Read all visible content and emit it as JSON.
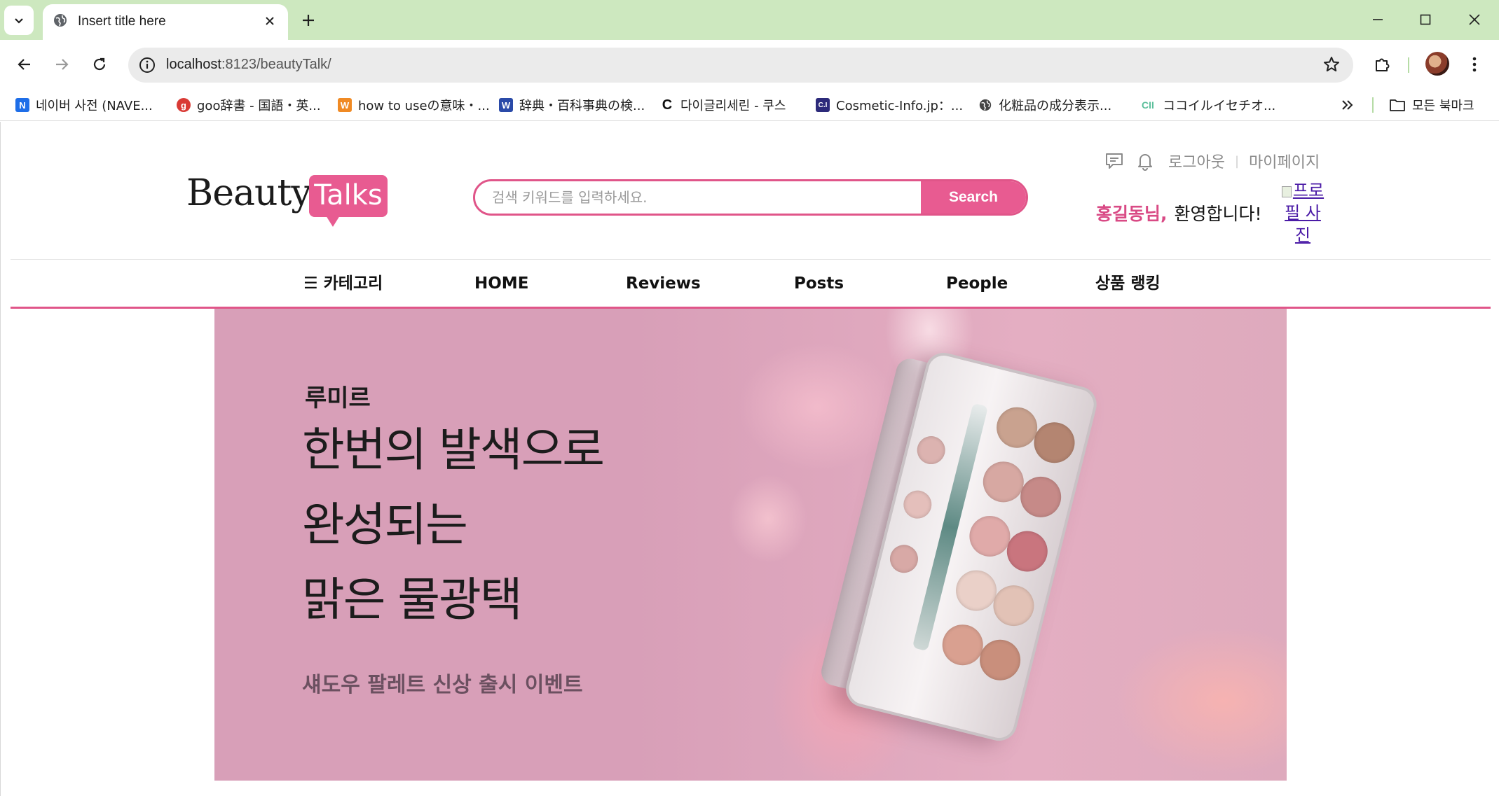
{
  "browser": {
    "tab_title": "Insert title here",
    "url_host": "localhost",
    "url_rest": ":8123/beautyTalk/",
    "bookmarks": [
      {
        "label": "네이버 사전 (NAVE...",
        "icon": "naver-icon",
        "color": "#1e6ee8"
      },
      {
        "label": "goo辞書 - 国語・英...",
        "icon": "goo-icon",
        "color": "#d93a35"
      },
      {
        "label": "how to useの意味・...",
        "icon": "weblio-icon",
        "color": "#f08a24"
      },
      {
        "label": "辞典・百科事典の検...",
        "icon": "kotobank-icon",
        "color": "#2a4aa8"
      },
      {
        "label": "다이글리세린 - 쿠스",
        "icon": "coos-icon",
        "color": "#111111"
      },
      {
        "label": "Cosmetic-Info.jp：...",
        "icon": "cosmetic-info-icon",
        "color": "#2c2a7a"
      },
      {
        "label": "化粧品の成分表示...",
        "icon": "globe-icon",
        "color": "#444444"
      },
      {
        "label": "ココイルイセチオ...",
        "icon": "ci-icon",
        "color": "#5bbf9b"
      }
    ],
    "all_bookmarks_label": "모든 북마크"
  },
  "header": {
    "logo_word": "Beauty",
    "logo_bubble": "Talks",
    "search_placeholder": "검색 키워드를 입력하세요.",
    "search_button": "Search",
    "logout": "로그아웃",
    "divider": "|",
    "mypage": "마이페이지",
    "welcome_name": "홍길동님,",
    "welcome_msg": "환영합니다!",
    "profile_alt": "프로필 사진"
  },
  "nav": {
    "category": "☰ 카테고리",
    "home": "HOME",
    "reviews": "Reviews",
    "posts": "Posts",
    "people": "People",
    "ranking": "상품 랭킹"
  },
  "banner": {
    "brand": "루미르",
    "headline": [
      "한번의 발색으로",
      "완성되는",
      "맑은 물광택"
    ],
    "subline": "섀도우 팔레트 신상 출시 이벤트",
    "bg_color": "#d89fb8"
  },
  "colors": {
    "accent": "#e85b91",
    "tabstrip": "#cde8bf"
  }
}
